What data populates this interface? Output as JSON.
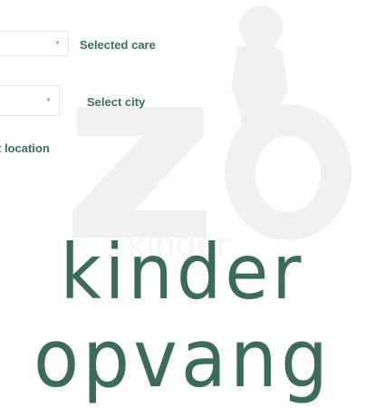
{
  "form": {
    "care_label": "Selected care",
    "city_label": "Select city",
    "location_label": "t location",
    "care_chevron": "chevron-down-icon",
    "city_chevron": "chevron-down-icon"
  },
  "logo": {
    "line1": "kinder",
    "line2": "opvang",
    "watermark_text": "ZO",
    "watermark_small": "kinder"
  },
  "colors": {
    "brand": "#3d6b5a",
    "watermark": "#eef1ef"
  }
}
